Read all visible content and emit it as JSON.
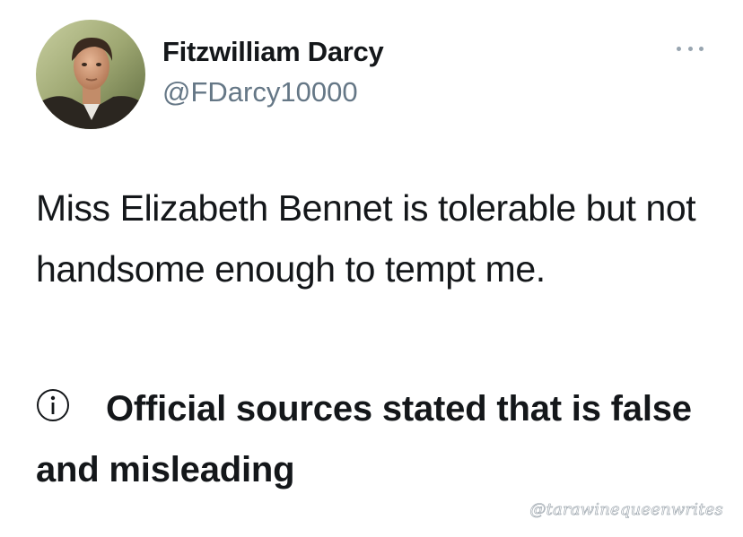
{
  "tweet": {
    "author": {
      "display_name": "Fitzwilliam Darcy",
      "handle": "@FDarcy10000",
      "avatar": "avatar-photo"
    },
    "more_menu_icon": "more-horizontal-icon",
    "text": "Miss Elizabeth Bennet is tolerable but not handsome enough to tempt me.",
    "notice": {
      "icon": "info-icon",
      "text": "Official sources stated that is false and misleading"
    }
  },
  "watermark": "@tarawinequeenwrites",
  "colors": {
    "text": "#14171a",
    "handle": "#657786",
    "icon_gray": "#98a5b0",
    "background": "#ffffff"
  }
}
